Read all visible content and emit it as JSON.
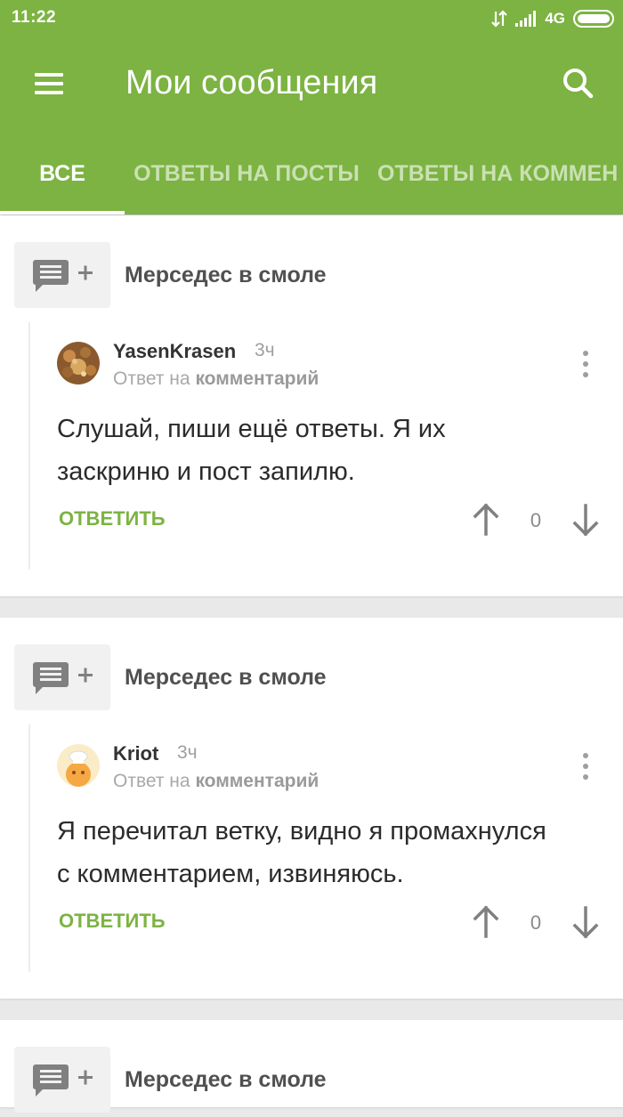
{
  "status": {
    "time": "11:22",
    "network": "4G"
  },
  "appbar": {
    "title": "Мои сообщения"
  },
  "tabs": [
    {
      "label": "ВСЕ",
      "active": true
    },
    {
      "label": "ОТВЕТЫ НА ПОСТЫ",
      "active": false
    },
    {
      "label": "ОТВЕТЫ НА КОММЕН",
      "active": false
    }
  ],
  "colors": {
    "accent": "#7cb342",
    "text": "#2b2b2b",
    "muted": "#9e9e9e"
  },
  "items": [
    {
      "post_title": "Мерседес в смоле",
      "author": "YasenKrasen",
      "time": "3ч",
      "reply_prefix": "Ответ на",
      "reply_target": "комментарий",
      "text_line1": "Слушай, пиши ещё ответы. Я их",
      "text_line2": "заскриню и пост запилю.",
      "reply_label": "ОТВЕТИТЬ",
      "rating": "0"
    },
    {
      "post_title": "Мерседес в смоле",
      "author": "Kriot",
      "time": "3ч",
      "reply_prefix": "Ответ на",
      "reply_target": "комментарий",
      "text_line1": "Я перечитал ветку, видно я промахнулся",
      "text_line2": "с комментарием, извиняюсь.",
      "reply_label": "ОТВЕТИТЬ",
      "rating": "0"
    },
    {
      "post_title": "Мерседес в смоле"
    }
  ]
}
